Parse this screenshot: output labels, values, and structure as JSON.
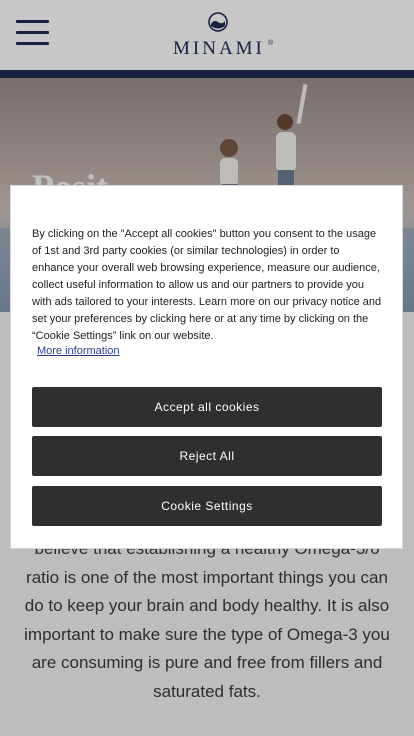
{
  "header": {
    "logo_text": "MINAMI",
    "logo_reg": "®",
    "accent_color": "#1f2a55"
  },
  "hero": {
    "title_fragment": "Posit"
  },
  "body": {
    "paragraph": "believe that establishing a healthy Omega-3/6 ratio is one of the most important things you can do to keep your brain and body healthy. It is also important to make sure the type of Omega-3 you are consuming is pure and free from fillers and saturated fats."
  },
  "cookie_banner": {
    "text": "By clicking on the \"Accept all cookies\" button you consent to the usage of 1st and 3rd party cookies (or similar technologies) in order to enhance your overall web browsing experience, measure our audience, collect useful information to allow us and our partners to provide you with ads tailored to your interests. Learn more on our privacy notice and set your preferences by clicking here or at any time by clicking on the “Cookie Settings” link on our website.",
    "more_info_label": "More information",
    "accept_label": "Accept all cookies",
    "reject_label": "Reject All",
    "settings_label": "Cookie Settings"
  }
}
